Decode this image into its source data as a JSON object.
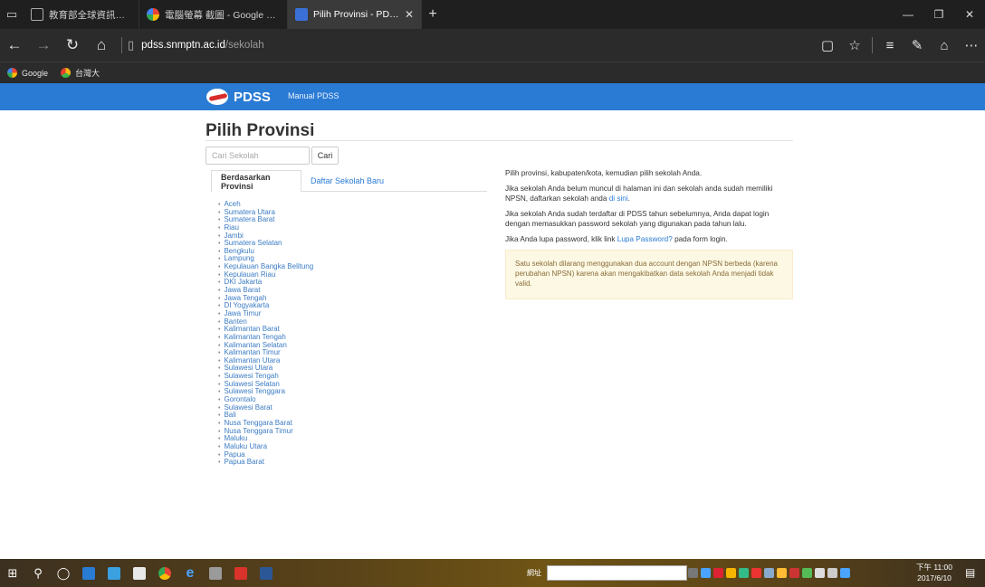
{
  "browser": {
    "tabs": [
      {
        "label": "教育部全球資訊網-本部各單",
        "icon": "window-icon",
        "active": false
      },
      {
        "label": "電腦螢幕 截圖 - Google 搜尋",
        "icon": "google-icon",
        "active": false
      },
      {
        "label": "Pilih Provinsi - PDSS",
        "icon": "pdss-favicon",
        "active": true
      }
    ],
    "close_glyph": "✕",
    "new_tab_glyph": "+",
    "address": {
      "host": "pdss.snmptn.ac.id",
      "path": "/sekolah"
    },
    "favorites": [
      {
        "label": "Google",
        "icon": "google-icon"
      },
      {
        "label": "台灣大",
        "icon": "taiwan-mobile-icon"
      }
    ]
  },
  "header": {
    "brand": "PDSS",
    "menu_link": "Manual PDSS",
    "bg_color": "#2a7bd4"
  },
  "main": {
    "title": "Pilih Provinsi",
    "search": {
      "placeholder": "Cari Sekolah",
      "button": "Cari"
    },
    "tabs": [
      {
        "label": "Berdasarkan Provinsi",
        "active": true
      },
      {
        "label": "Daftar Sekolah Baru",
        "active": false
      }
    ],
    "provinces": [
      "Aceh",
      "Sumatera Utara",
      "Sumatera Barat",
      "Riau",
      "Jambi",
      "Sumatera Selatan",
      "Bengkulu",
      "Lampung",
      "Kepulauan Bangka Belitung",
      "Kepulauan Riau",
      "DKI Jakarta",
      "Jawa Barat",
      "Jawa Tengah",
      "DI Yogyakarta",
      "Jawa Timur",
      "Banten",
      "Kalimantan Barat",
      "Kalimantan Tengah",
      "Kalimantan Selatan",
      "Kalimantan Timur",
      "Kalimantan Utara",
      "Sulawesi Utara",
      "Sulawesi Tengah",
      "Sulawesi Selatan",
      "Sulawesi Tenggara",
      "Gorontalo",
      "Sulawesi Barat",
      "Bali",
      "Nusa Tenggara Barat",
      "Nusa Tenggara Timur",
      "Maluku",
      "Maluku Utara",
      "Papua",
      "Papua Barat"
    ],
    "info": {
      "p1": "Pilih provinsi, kabupaten/kota, kemudian pilih sekolah Anda.",
      "p2_text": "Jika sekolah Anda belum muncul di halaman ini dan sekolah anda sudah memiliki NPSN, daftarkan sekolah anda ",
      "p2_link": "di sini",
      "p2_end": ".",
      "p3": "Jika sekolah Anda sudah terdaftar di PDSS tahun sebelumnya, Anda dapat login dengan memasukkan password sekolah yang digunakan pada tahun lalu.",
      "p4_text": "Jika Anda lupa password, klik link ",
      "p4_link": "Lupa Password?",
      "p4_end": " pada form login.",
      "warning": "Satu sekolah dilarang menggunakan dua account dengan NPSN berbeda (karena perubahan NPSN) karena akan mengakibatkan data sekolah Anda menjadi tidak valid."
    }
  },
  "taskbar": {
    "search_label": "網址",
    "clock_time": "下午 11:00",
    "clock_date": "2017/6/10"
  }
}
